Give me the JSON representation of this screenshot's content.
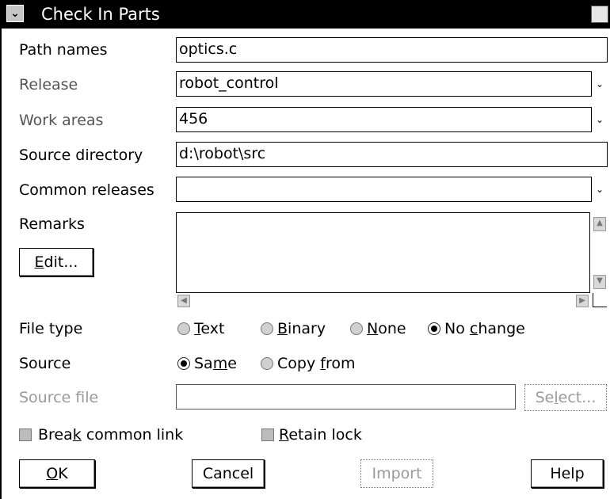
{
  "window": {
    "title": "Check In Parts",
    "sysmenu_glyph": "⌄"
  },
  "form": {
    "path_names": {
      "label": "Path names",
      "value": "optics.c"
    },
    "release": {
      "label": "Release",
      "value": "robot_control"
    },
    "work_areas": {
      "label": "Work areas",
      "value": "456"
    },
    "source_directory": {
      "label": "Source directory",
      "value": "d:\\robot\\src"
    },
    "common_releases": {
      "label": "Common releases",
      "value": ""
    },
    "remarks": {
      "label": "Remarks",
      "value": "",
      "edit_button": "Edit..."
    },
    "file_type": {
      "label": "File type",
      "options": [
        "Text",
        "Binary",
        "None",
        "No change"
      ],
      "selected": "No change"
    },
    "source": {
      "label": "Source",
      "options": [
        "Same",
        "Copy from"
      ],
      "selected": "Same"
    },
    "source_file": {
      "label": "Source file",
      "value": "",
      "select_button": "Select..."
    },
    "checkboxes": {
      "break_common_link": "Break common link",
      "retain_lock": "Retain lock"
    }
  },
  "buttons": {
    "ok": "OK",
    "cancel": "Cancel",
    "import": "Import",
    "help": "Help"
  },
  "icons": {
    "dropdown": "dropdown-arrow-icon",
    "scroll_up": "scroll-up-icon",
    "scroll_down": "scroll-down-icon",
    "scroll_left": "scroll-left-icon",
    "scroll_right": "scroll-right-icon"
  }
}
